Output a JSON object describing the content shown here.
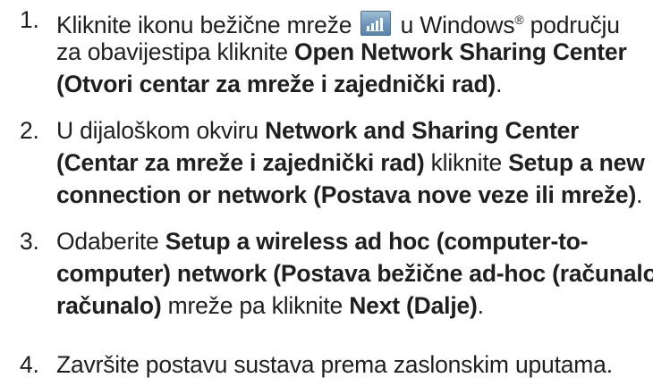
{
  "steps": [
    {
      "number": "1.",
      "l1_a": "Kliknite ikonu bežične mreže",
      "l1_b": "u Windows",
      "l1_c": "®",
      "l1_d": " području",
      "l2_a": "za obavijestipa kliknite ",
      "l2_b": "Open Network Sharing Center",
      "l3_a": "(Otvori centar za mreže i zajednički rad)",
      "l3_b": "."
    },
    {
      "number": "2.",
      "l1_a": "U dijaloškom okviru ",
      "l1_b": "Network and Sharing Center",
      "l2_a": "(Centar za mreže i zajednički rad)",
      "l2_b": " kliknite ",
      "l2_c": "Setup a new",
      "l3_a": "connection or network (Postava nove veze ili mreže)",
      "l3_b": "."
    },
    {
      "number": "3.",
      "l1_a": "Odaberite ",
      "l1_b": "Setup a wireless ad hoc (computer-to-",
      "l2_a": "computer) network (Postava bežične ad-hoc (računalo-",
      "l3_a": "računalo)",
      "l3_b": " mreže pa kliknite ",
      "l3_c": "Next (Dalje)",
      "l3_d": "."
    },
    {
      "number": "4.",
      "l1_a": "Završite postavu sustava prema zaslonskim uputama."
    }
  ],
  "icons": {
    "wireless": "wireless-signal-icon"
  }
}
